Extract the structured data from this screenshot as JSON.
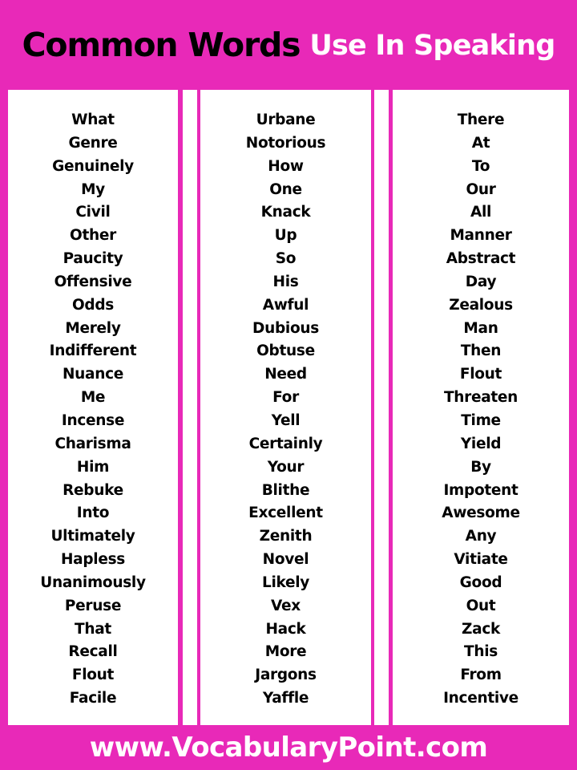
{
  "header": {
    "title_part1": "Common Words",
    "title_part2": "Use In Speaking"
  },
  "columns": [
    {
      "words": [
        "What",
        "Genre",
        "Genuinely",
        "My",
        "Civil",
        "Other",
        "Paucity",
        "Offensive",
        "Odds",
        "Merely",
        "Indifferent",
        "Nuance",
        "Me",
        "Incense",
        "Charisma",
        "Him",
        "Rebuke",
        "Into",
        "Ultimately",
        "Hapless",
        "Unanimously",
        "Peruse",
        "That",
        "Recall",
        "Flout",
        "Facile"
      ]
    },
    {
      "words": [
        "Urbane",
        "Notorious",
        "How",
        "One",
        "Knack",
        "Up",
        "So",
        "His",
        "Awful",
        "Dubious",
        "Obtuse",
        "Need",
        "For",
        "Yell",
        "Certainly",
        "Your",
        "Blithe",
        "Excellent",
        "Zenith",
        "Novel",
        "Likely",
        "Vex",
        "Hack",
        "More",
        "Jargons",
        "Yaffle"
      ]
    },
    {
      "words": [
        "There",
        "At",
        "To",
        "Our",
        "All",
        "Manner",
        "Abstract",
        "Day",
        "Zealous",
        "Man",
        "Then",
        "Flout",
        "Threaten",
        "Time",
        "Yield",
        "By",
        "Impotent",
        "Awesome",
        "Any",
        "Vitiate",
        "Good",
        "Out",
        "Zack",
        "This",
        "From",
        "Incentive"
      ]
    }
  ],
  "footer": {
    "website": "www.VocabularyPoint.com"
  },
  "colors": {
    "accent": "#e829b8",
    "panel": "#ffffff",
    "text": "#000000"
  }
}
